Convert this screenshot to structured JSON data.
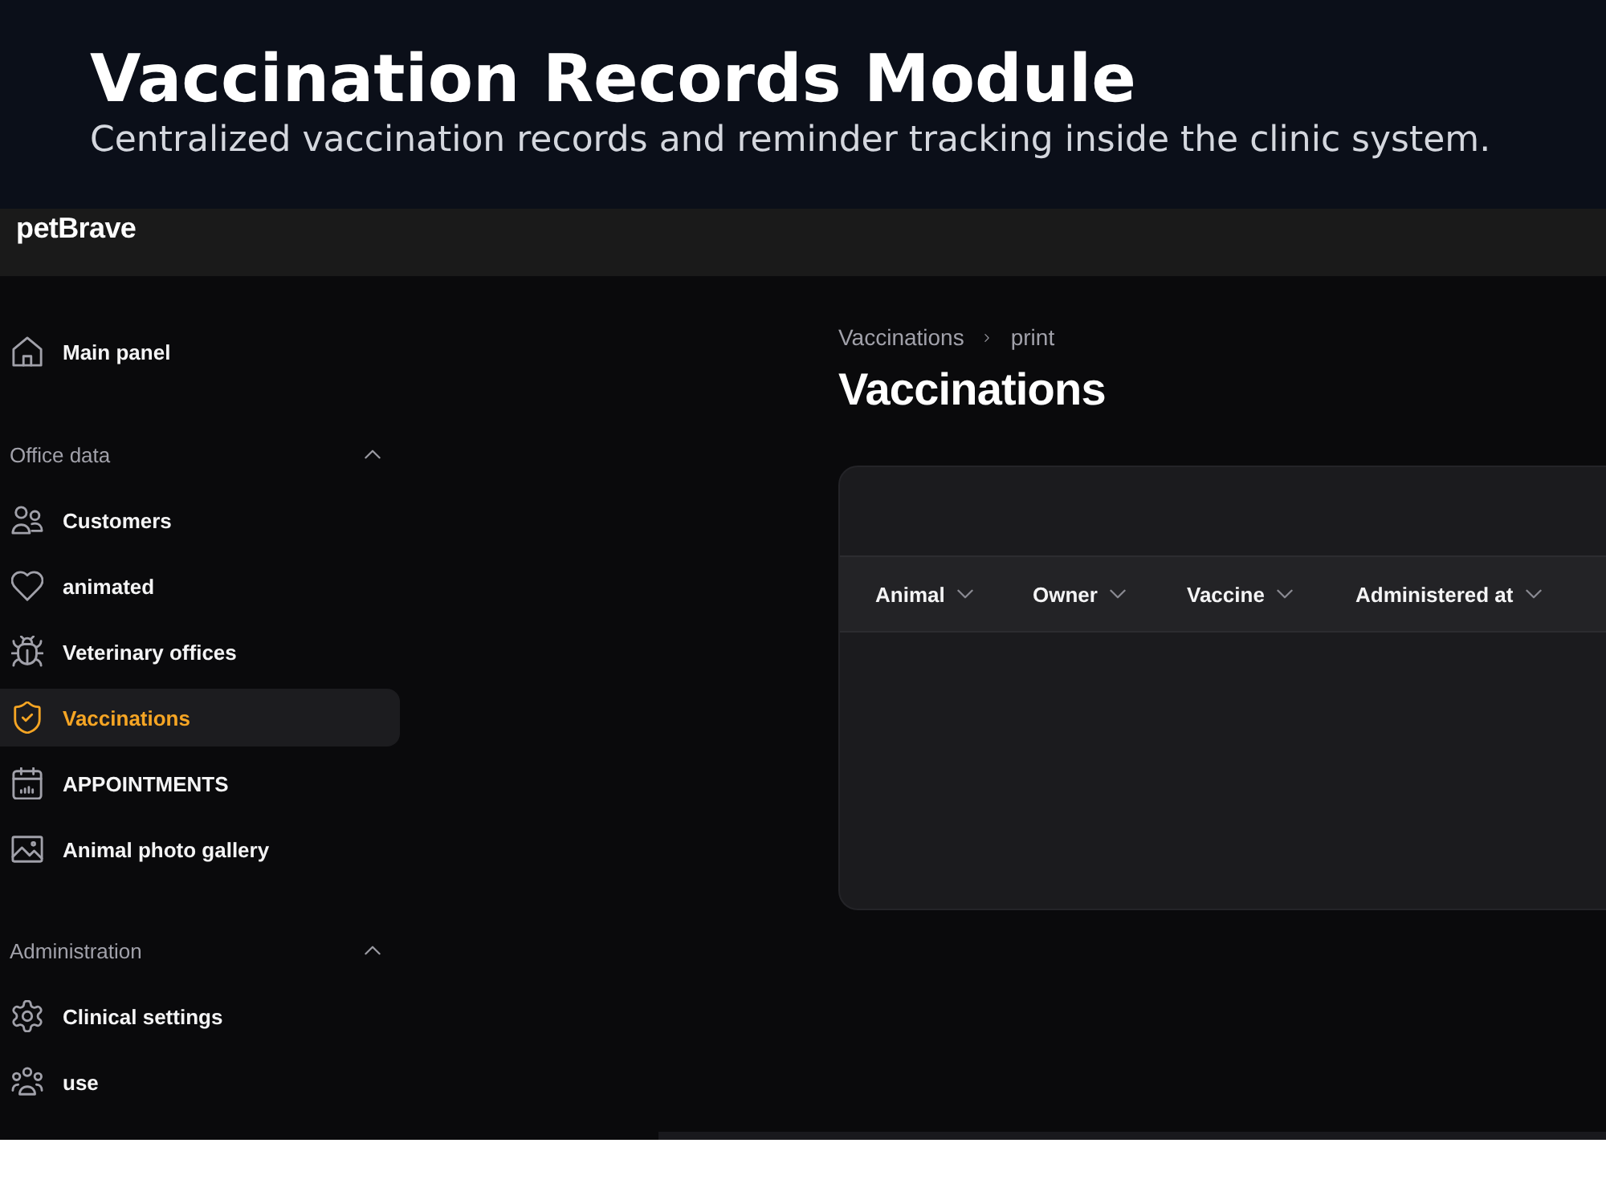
{
  "banner": {
    "title": "Vaccination Records Module",
    "subtitle": "Centralized vaccination records and reminder tracking inside the clinic system."
  },
  "topbar": {
    "logo": "petBrave"
  },
  "sidebar": {
    "items": [
      {
        "label": "Main panel",
        "selected": false
      }
    ],
    "groups": [
      {
        "label": "Office data",
        "expanded": true,
        "items": [
          {
            "label": "Customers",
            "selected": false
          },
          {
            "label": "animated",
            "selected": false
          },
          {
            "label": "Veterinary offices",
            "selected": false
          },
          {
            "label": "Vaccinations",
            "selected": true
          },
          {
            "label": "APPOINTMENTS",
            "selected": false
          },
          {
            "label": "Animal photo gallery",
            "selected": false
          }
        ]
      },
      {
        "label": "Administration",
        "expanded": true,
        "items": [
          {
            "label": "Clinical settings",
            "selected": false
          },
          {
            "label": "use",
            "selected": false
          }
        ]
      }
    ]
  },
  "breadcrumb": [
    "Vaccinations",
    "print"
  ],
  "page_title": "Vaccinations",
  "table": {
    "columns": [
      "Animal",
      "Owner",
      "Vaccine",
      "Administered at"
    ]
  }
}
